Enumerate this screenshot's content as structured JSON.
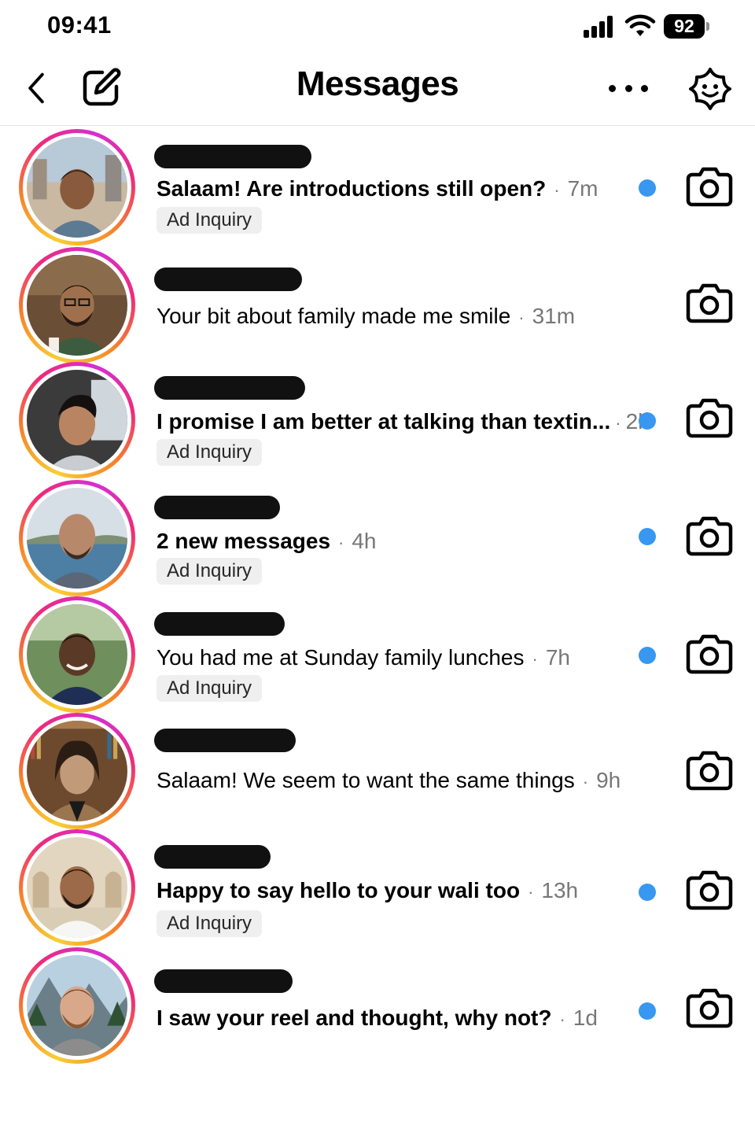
{
  "status_bar": {
    "time": "09:41",
    "battery": "92",
    "icons": [
      "signal-icon",
      "wifi-icon",
      "battery-icon"
    ]
  },
  "header": {
    "title": "Messages",
    "icons": [
      "back-icon",
      "compose-icon",
      "more-icon",
      "ai-assistant-icon"
    ]
  },
  "colors": {
    "unread": "#3897f0",
    "tag_bg": "#efefef",
    "ring_start": "#f9ce34",
    "ring_mid": "#ee2a7b",
    "ring_end": "#d62fd2"
  },
  "threads": [
    {
      "message": "Salaam! Are introductions still open?",
      "separator": "·",
      "time": "7m",
      "bold": true,
      "unread": true,
      "tag": "Ad Inquiry"
    },
    {
      "message": "Your bit about family made me smile",
      "separator": "·",
      "time": "31m",
      "bold": false,
      "unread": false,
      "tag": ""
    },
    {
      "message": "I promise I am better at talking than textin...",
      "separator": "·",
      "time": "2h",
      "bold": true,
      "unread": true,
      "tag": "Ad Inquiry"
    },
    {
      "message": "2 new messages",
      "separator": "·",
      "time": "4h",
      "bold": true,
      "unread": true,
      "tag": "Ad Inquiry"
    },
    {
      "message": "You had me at Sunday family lunches",
      "separator": "·",
      "time": "7h",
      "bold": false,
      "unread": true,
      "tag": "Ad Inquiry"
    },
    {
      "message": "Salaam! We seem to want the same things",
      "separator": "·",
      "time": "9h",
      "bold": false,
      "unread": false,
      "tag": ""
    },
    {
      "message": "Happy to say hello to your wali too",
      "separator": "·",
      "time": "13h",
      "bold": true,
      "unread": true,
      "tag": "Ad Inquiry"
    },
    {
      "message": "I saw your reel and thought, why not?",
      "separator": "·",
      "time": "1d",
      "bold": true,
      "unread": true,
      "tag": ""
    }
  ]
}
